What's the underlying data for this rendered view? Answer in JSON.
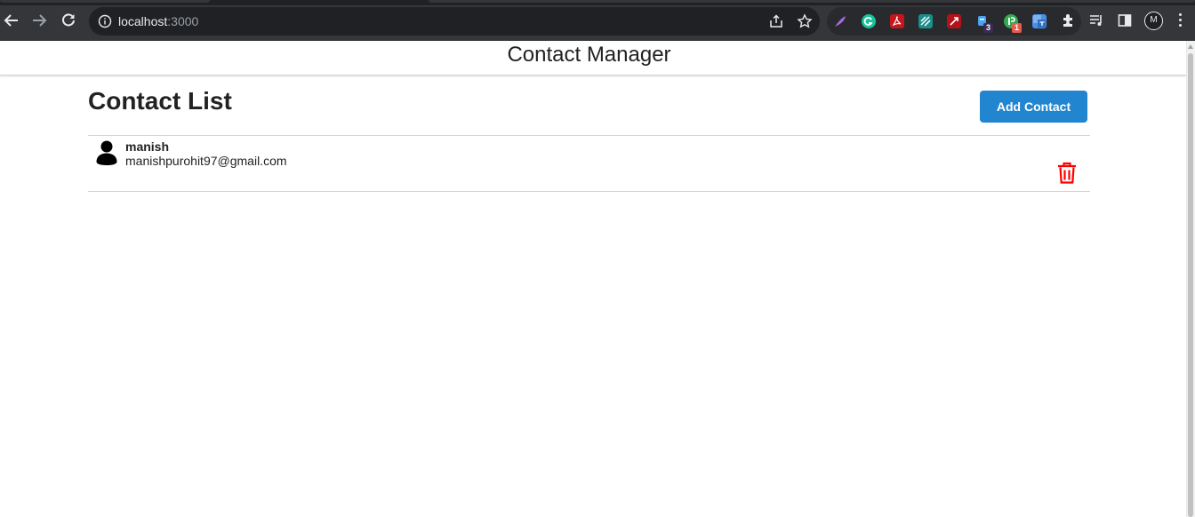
{
  "browser": {
    "url_host": "localhost",
    "url_port": ":3000",
    "profile_initial": "M",
    "extensions": [
      {
        "icon": "quill-icon",
        "color": "#7b3fb8"
      },
      {
        "icon": "grammarly-icon",
        "color": "#15c39a"
      },
      {
        "icon": "acrobat-icon",
        "color": "#d4141b"
      },
      {
        "icon": "teal-extension-icon",
        "color": "#1aa39a"
      },
      {
        "icon": "red-extension-icon",
        "color": "#c4161c"
      },
      {
        "icon": "blue-extension-icon",
        "color": "#1a73e8",
        "badge": "3"
      },
      {
        "icon": "green-extension-icon",
        "color": "#34a853",
        "badge": "1"
      },
      {
        "icon": "translate-icon",
        "color": "#4a90e2"
      }
    ]
  },
  "app": {
    "title": "Contact Manager",
    "list_heading": "Contact List",
    "add_button_label": "Add Contact",
    "accent_color": "#2185d0",
    "delete_color": "#db2828"
  },
  "contacts": [
    {
      "name": "manish",
      "email": "manishpurohit97@gmail.com"
    }
  ]
}
